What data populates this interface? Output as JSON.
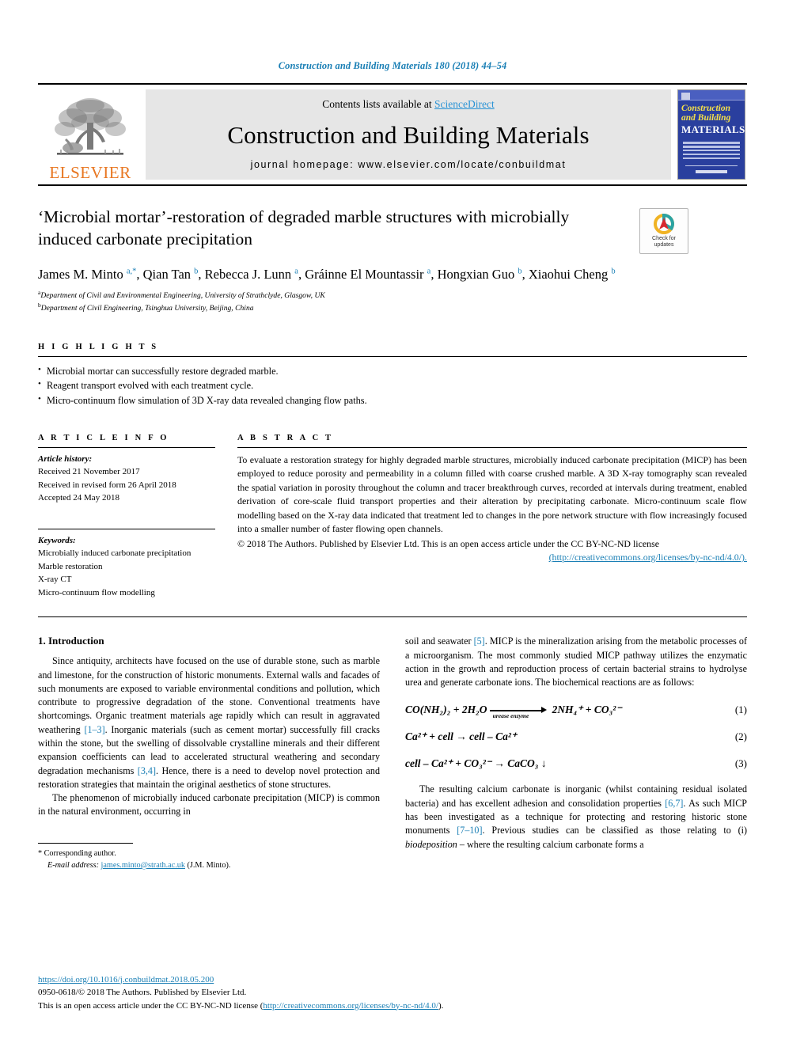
{
  "running_head": "Construction and Building Materials 180 (2018) 44–54",
  "masthead": {
    "elsevier_wordmark": "ELSEVIER",
    "contents_prefix": "Contents lists available at ",
    "sciencedirect": "ScienceDirect",
    "journal_title": "Construction and Building Materials",
    "homepage": "journal homepage: www.elsevier.com/locate/conbuildmat",
    "cover": {
      "line1": "Construction",
      "line2": "and Building",
      "line3": "MATERIALS"
    }
  },
  "article": {
    "title": "‘Microbial mortar’-restoration of degraded marble structures with microbially induced carbonate precipitation",
    "crossmark_label": "Check for\nupdates",
    "authors_html": "James M. Minto <sup>a,</sup><sup>*</sup>, Qian Tan <sup>b</sup>, Rebecca J. Lunn <sup>a</sup>, Gráinne El Mountassir <sup>a</sup>, Hongxian Guo <sup>b</sup>, Xiaohui Cheng <sup>b</sup>",
    "affiliations": [
      {
        "marker": "a",
        "text": "Department of Civil and Environmental Engineering, University of Strathclyde, Glasgow, UK"
      },
      {
        "marker": "b",
        "text": "Department of Civil Engineering, Tsinghua University, Beijing, China"
      }
    ]
  },
  "highlights": {
    "heading": "H I G H L I G H T S",
    "items": [
      "Microbial mortar can successfully restore degraded marble.",
      "Reagent transport evolved with each treatment cycle.",
      "Micro-continuum flow simulation of 3D X-ray data revealed changing flow paths."
    ]
  },
  "article_info": {
    "heading": "A R T I C L E   I N F O",
    "history_label": "Article history:",
    "history": [
      "Received 21 November 2017",
      "Received in revised form 26 April 2018",
      "Accepted 24 May 2018"
    ],
    "keywords_label": "Keywords:",
    "keywords": [
      "Microbially induced carbonate precipitation",
      "Marble restoration",
      "X-ray CT",
      "Micro-continuum flow modelling"
    ]
  },
  "abstract": {
    "heading": "A B S T R A C T",
    "body": "To evaluate a restoration strategy for highly degraded marble structures, microbially induced carbonate precipitation (MICP) has been employed to reduce porosity and permeability in a column filled with coarse crushed marble. A 3D X-ray tomography scan revealed the spatial variation in porosity throughout the column and tracer breakthrough curves, recorded at intervals during treatment, enabled derivation of core-scale fluid transport properties and their alteration by precipitating carbonate. Micro-continuum scale flow modelling based on the X-ray data indicated that treatment led to changes in the pore network structure with flow increasingly focused into a smaller number of faster flowing open channels.",
    "copyright": "© 2018 The Authors. Published by Elsevier Ltd. This is an open access article under the CC BY-NC-ND license",
    "license_url": "(http://creativecommons.org/licenses/by-nc-nd/4.0/)."
  },
  "introduction": {
    "heading": "1. Introduction",
    "left_paragraphs": [
      {
        "segments": [
          {
            "t": "Since antiquity, architects have focused on the use of durable stone, such as marble and limestone, for the construction of historic monuments. External walls and facades of such monuments are exposed to variable environmental conditions and pollution, which contribute to progressive degradation of the stone. Conventional treatments have shortcomings. Organic treatment materials age rapidly which can result in aggravated weathering "
          },
          {
            "t": "[1–3]",
            "ref": true
          },
          {
            "t": ". Inorganic materials (such as cement mortar) successfully fill cracks within the stone, but the swelling of dissolvable crystalline minerals and their different expansion coefficients can lead to accelerated structural weathering and secondary degradation mechanisms "
          },
          {
            "t": "[3,4]",
            "ref": true
          },
          {
            "t": ". Hence, there is a need to develop novel protection and restoration strategies that maintain the original aesthetics of stone structures."
          }
        ]
      },
      {
        "segments": [
          {
            "t": "The phenomenon of microbially induced carbonate precipitation (MICP) is common in the natural environment, occurring in"
          }
        ]
      }
    ],
    "right_paragraph_1": [
      {
        "t": "soil and seawater "
      },
      {
        "t": "[5]",
        "ref": true
      },
      {
        "t": ". MICP is the mineralization arising from the metabolic processes of a microorganism. The most commonly studied MICP pathway utilizes the enzymatic action in the growth and reproduction process of certain bacterial strains to hydrolyse urea and generate carbonate ions. The biochemical reactions are as follows:"
      }
    ],
    "right_paragraph_2": [
      {
        "t": "The resulting calcium carbonate is inorganic (whilst containing residual isolated bacteria) and has excellent adhesion and consolidation properties "
      },
      {
        "t": "[6,7]",
        "ref": true
      },
      {
        "t": ". As such MICP has been investigated as a technique for protecting and restoring historic stone monuments "
      },
      {
        "t": "[7–10]",
        "ref": true
      },
      {
        "t": ". Previous studies can be classified as those relating to (i) "
      },
      {
        "t": "biodeposition",
        "italic": true
      },
      {
        "t": " – where the resulting calcium carbonate forms a"
      }
    ]
  },
  "equations": [
    {
      "number": "(1)",
      "lhs": "CO(NH₂)₂ + 2H₂O",
      "arrow_label": "urease  enzyme",
      "rhs": "2NH₄⁺ + CO₃²⁻"
    },
    {
      "number": "(2)",
      "text": "Ca²⁺ + cell → cell – Ca²⁺"
    },
    {
      "number": "(3)",
      "text": "cell – Ca²⁺ + CO₃²⁻ → CaCO₃ ↓"
    }
  ],
  "footnote": {
    "corresponding": "* Corresponding author.",
    "email_label": "E-mail address:",
    "email": "james.minto@strath.ac.uk",
    "email_owner": "(J.M. Minto)."
  },
  "footer": {
    "doi": "https://doi.org/10.1016/j.conbuildmat.2018.05.200",
    "issn_line": "0950-0618/© 2018 The Authors. Published by Elsevier Ltd.",
    "license_prefix": "This is an open access article under the CC BY-NC-ND license (",
    "license_url": "http://creativecommons.org/licenses/by-nc-nd/4.0/",
    "license_suffix": ")."
  },
  "colors": {
    "link": "#1a7fb5",
    "elsevier_orange": "#e87722",
    "cover_blue": "#2a3f9e",
    "band_grey": "#e6e6e6"
  }
}
